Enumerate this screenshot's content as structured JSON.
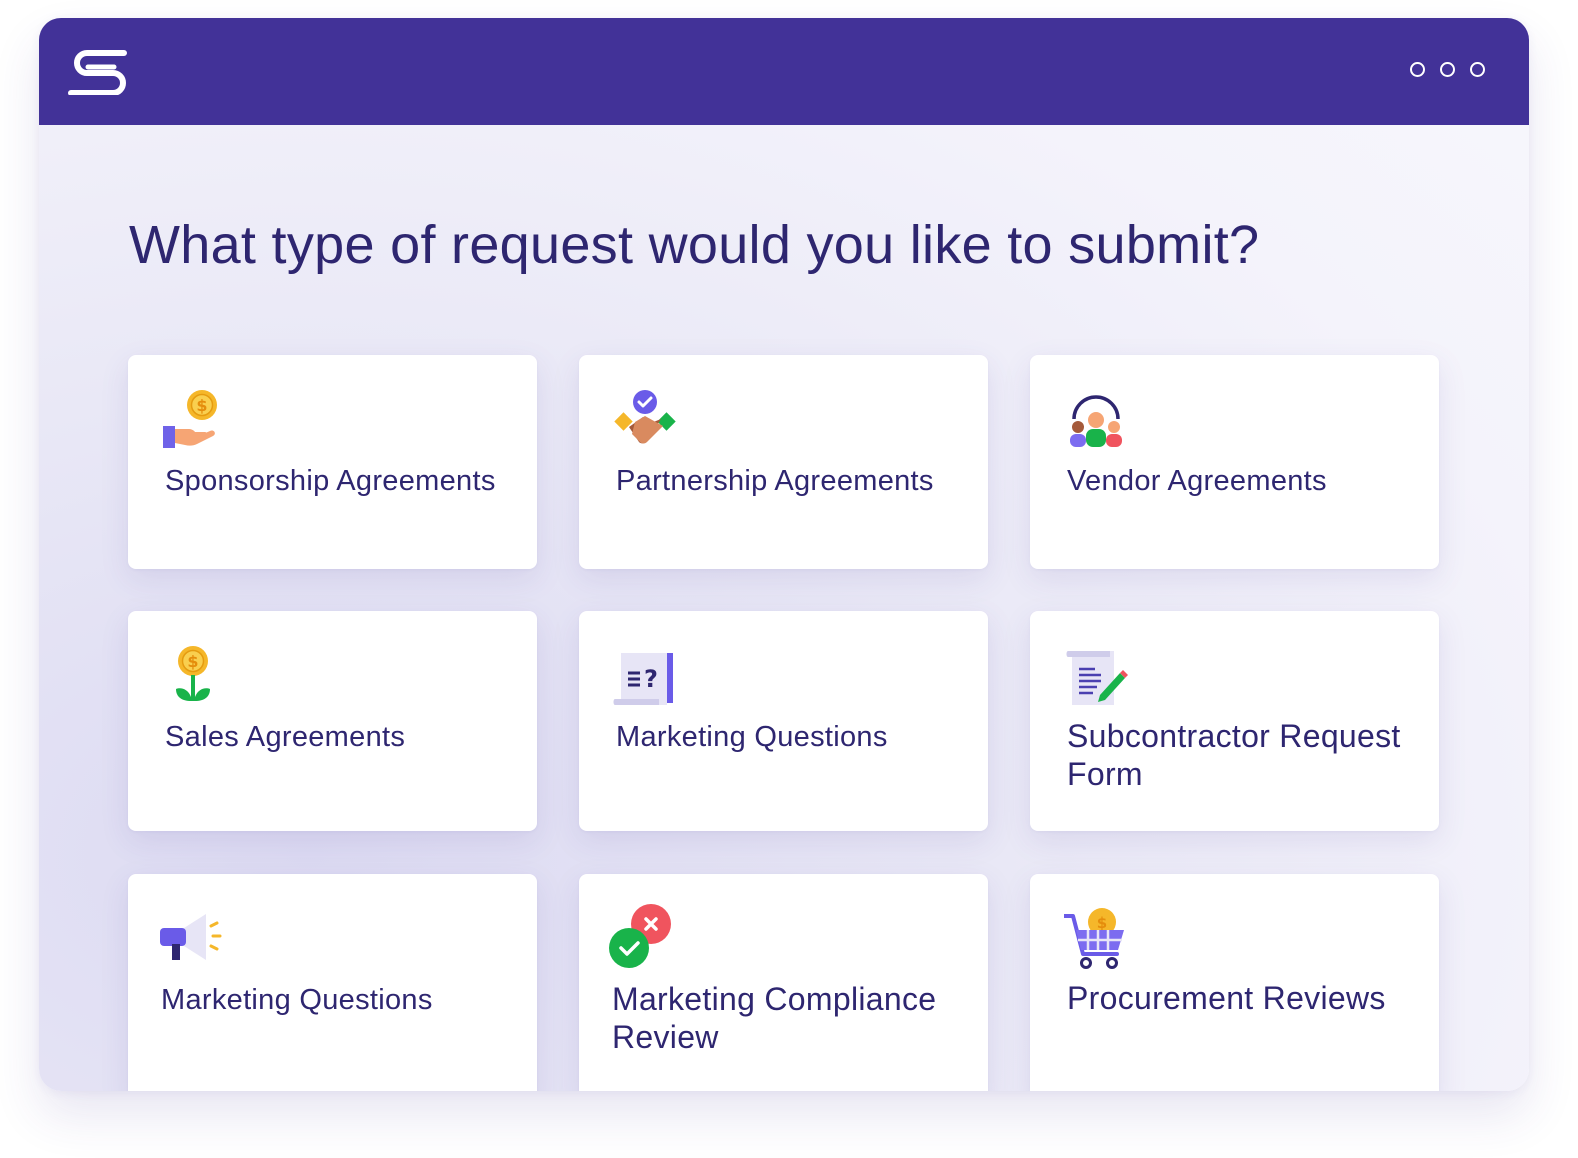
{
  "app": {
    "window_controls": [
      "more-dot",
      "more-dot",
      "more-dot"
    ]
  },
  "page": {
    "heading": "What type of request would you like to submit?"
  },
  "cards": [
    {
      "label": "Sponsorship Agreements",
      "icon": "coin-in-hand-icon"
    },
    {
      "label": "Partnership Agreements",
      "icon": "handshake-icon"
    },
    {
      "label": "Vendor Agreements",
      "icon": "team-headset-icon"
    },
    {
      "label": "Sales Agreements",
      "icon": "money-plant-icon"
    },
    {
      "label": "Marketing Questions",
      "icon": "document-question-icon"
    },
    {
      "label": "Subcontractor Request Form",
      "icon": "document-pen-icon"
    },
    {
      "label": "Marketing Questions",
      "icon": "megaphone-icon"
    },
    {
      "label": "Marketing Compliance Review",
      "icon": "check-cross-icon"
    },
    {
      "label": "Procurement Reviews",
      "icon": "shopping-cart-icon"
    }
  ],
  "colors": {
    "brand": "#423298",
    "text": "#2e2670",
    "coin": "#f5b72a",
    "green": "#19b34a",
    "red": "#f0545e",
    "purple": "#7c6cf0"
  }
}
